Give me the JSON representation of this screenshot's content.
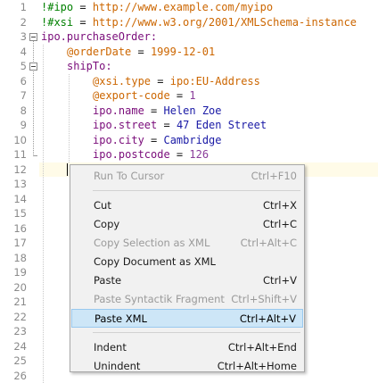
{
  "editor": {
    "line_numbers": [
      "1",
      "2",
      "3",
      "4",
      "5",
      "6",
      "7",
      "8",
      "9",
      "10",
      "11",
      "12",
      "13",
      "14",
      "15",
      "16",
      "17",
      "18",
      "19",
      "20",
      "21",
      "22",
      "23",
      "24",
      "25",
      "26"
    ],
    "lines": [
      {
        "indent": 0,
        "tokens": [
          {
            "t": "!#ipo",
            "c": "meta"
          },
          {
            "t": " = ",
            "c": "eq"
          },
          {
            "t": "http://www.example.com/myipo",
            "c": "str"
          }
        ]
      },
      {
        "indent": 0,
        "tokens": [
          {
            "t": "!#xsi",
            "c": "meta"
          },
          {
            "t": " = ",
            "c": "eq"
          },
          {
            "t": "http://www.w3.org/2001/XMLSchema-instance",
            "c": "str"
          }
        ]
      },
      {
        "indent": 0,
        "tokens": [
          {
            "t": "ipo.purchaseOrder:",
            "c": "kw"
          }
        ]
      },
      {
        "indent": 1,
        "tokens": [
          {
            "t": "@orderDate",
            "c": "str"
          },
          {
            "t": " = ",
            "c": "eq"
          },
          {
            "t": "1999-12-01",
            "c": "str"
          }
        ]
      },
      {
        "indent": 1,
        "tokens": [
          {
            "t": "shipTo:",
            "c": "kw"
          }
        ]
      },
      {
        "indent": 2,
        "tokens": [
          {
            "t": "@xsi.type",
            "c": "str"
          },
          {
            "t": " = ",
            "c": "eq"
          },
          {
            "t": "ipo:EU-Address",
            "c": "str"
          }
        ]
      },
      {
        "indent": 2,
        "tokens": [
          {
            "t": "@export-code",
            "c": "str"
          },
          {
            "t": " = ",
            "c": "eq"
          },
          {
            "t": "1",
            "c": "num"
          }
        ]
      },
      {
        "indent": 2,
        "tokens": [
          {
            "t": "ipo.name",
            "c": "kw"
          },
          {
            "t": " = ",
            "c": "eq"
          },
          {
            "t": "Helen Zoe",
            "c": "name"
          }
        ]
      },
      {
        "indent": 2,
        "tokens": [
          {
            "t": "ipo.street",
            "c": "kw"
          },
          {
            "t": " = ",
            "c": "eq"
          },
          {
            "t": "47 Eden Street",
            "c": "name"
          }
        ]
      },
      {
        "indent": 2,
        "tokens": [
          {
            "t": "ipo.city",
            "c": "kw"
          },
          {
            "t": " = ",
            "c": "eq"
          },
          {
            "t": "Cambridge",
            "c": "name"
          }
        ]
      },
      {
        "indent": 2,
        "tokens": [
          {
            "t": "ipo.postcode",
            "c": "kw"
          },
          {
            "t": " = ",
            "c": "eq"
          },
          {
            "t": "126",
            "c": "num"
          }
        ]
      }
    ]
  },
  "context_menu": {
    "items": [
      {
        "label": "Run To Cursor",
        "shortcut": "Ctrl+F10",
        "state": "disabled"
      },
      {
        "separator": true
      },
      {
        "label": "Cut",
        "shortcut": "Ctrl+X",
        "state": "enabled"
      },
      {
        "label": "Copy",
        "shortcut": "Ctrl+C",
        "state": "enabled"
      },
      {
        "label": "Copy Selection as XML",
        "shortcut": "Ctrl+Alt+C",
        "state": "disabled"
      },
      {
        "label": "Copy Document as XML",
        "shortcut": "",
        "state": "enabled"
      },
      {
        "label": "Paste",
        "shortcut": "Ctrl+V",
        "state": "enabled"
      },
      {
        "label": "Paste Syntactik Fragment",
        "shortcut": "Ctrl+Shift+V",
        "state": "disabled"
      },
      {
        "label": "Paste XML",
        "shortcut": "Ctrl+Alt+V",
        "state": "highlighted"
      },
      {
        "separator": true
      },
      {
        "label": "Indent",
        "shortcut": "Ctrl+Alt+End",
        "state": "enabled"
      },
      {
        "label": "Unindent",
        "shortcut": "Ctrl+Alt+Home",
        "state": "enabled"
      }
    ]
  }
}
